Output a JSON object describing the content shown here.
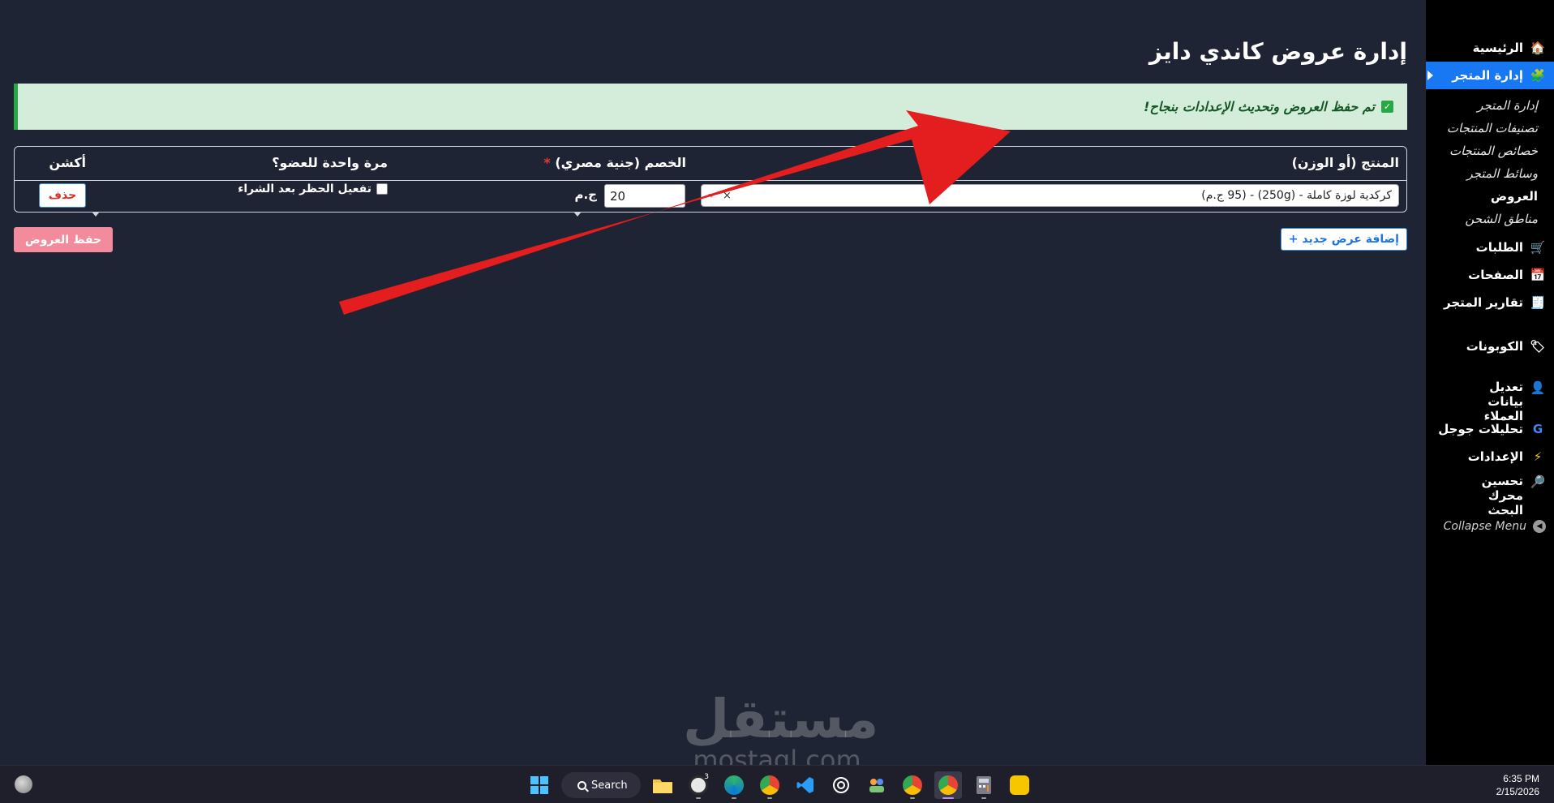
{
  "sidebar": {
    "items": [
      {
        "label": "الرئيسية",
        "icon": "house-icon",
        "glyph": "🏠"
      },
      {
        "label": "إدارة المتجر",
        "icon": "puzzle-icon",
        "glyph": "🧩"
      },
      {
        "label": "الطلبات",
        "icon": "cart-icon",
        "glyph": "🛒"
      },
      {
        "label": "الصفحات",
        "icon": "calendar-icon",
        "glyph": "📅"
      },
      {
        "label": "تقارير المتجر",
        "icon": "report-icon",
        "glyph": "🧾"
      },
      {
        "label": "الكوبونات",
        "icon": "coupon-icon",
        "glyph": "🏷"
      },
      {
        "label": "تعديل بيانات العملاء",
        "icon": "user-edit-icon",
        "glyph": "👤"
      },
      {
        "label": "تحليلات جوجل",
        "icon": "google-icon",
        "glyph": "G"
      },
      {
        "label": "الإعدادات",
        "icon": "lightning-icon",
        "glyph": "⚡"
      },
      {
        "label": "تحسين محرك البحث",
        "icon": "magnifier-icon",
        "glyph": "🔎"
      }
    ],
    "subitems": [
      "إدارة المتجر",
      "تصنيفات المنتجات",
      "خصائص المنتجات",
      "وسائط المتجر",
      "العروض",
      "مناطق الشحن"
    ],
    "collapse_label": "Collapse Menu"
  },
  "page": {
    "title": "إدارة عروض كاندي دايز",
    "alert": "تم حفظ العروض وتحديث الإعدادات بنجاح!"
  },
  "table": {
    "headers": {
      "product": "المنتج (أو الوزن)",
      "discount": "الخصم (جنية مصري)",
      "discount_required": "*",
      "once": "مرة واحدة للعضو؟",
      "action": "أكشن"
    },
    "row": {
      "product_value": "كركدية لوزة كاملة - (250g) - (95 ج.م)",
      "clear": "×",
      "discount_value": "20",
      "currency": "ج.م",
      "once_label": "تفعيل الحظر بعد الشراء",
      "delete_label": "حذف"
    }
  },
  "buttons": {
    "add": "إضافة عرض جديد +",
    "save": "حفظ العروض"
  },
  "watermark": {
    "ar": "مستقل",
    "en": "mostaql.com"
  },
  "taskbar": {
    "search_label": "Search",
    "whatsapp_badge": "3",
    "time": "6:35 PM",
    "date": "2/15/2026"
  },
  "colors": {
    "background": "#1e2433",
    "sidebar_active": "#1877f2",
    "alert_bg": "#d4edda",
    "alert_text": "#155724",
    "save_button": "#f28b9b",
    "arrow": "#e41e1e"
  }
}
